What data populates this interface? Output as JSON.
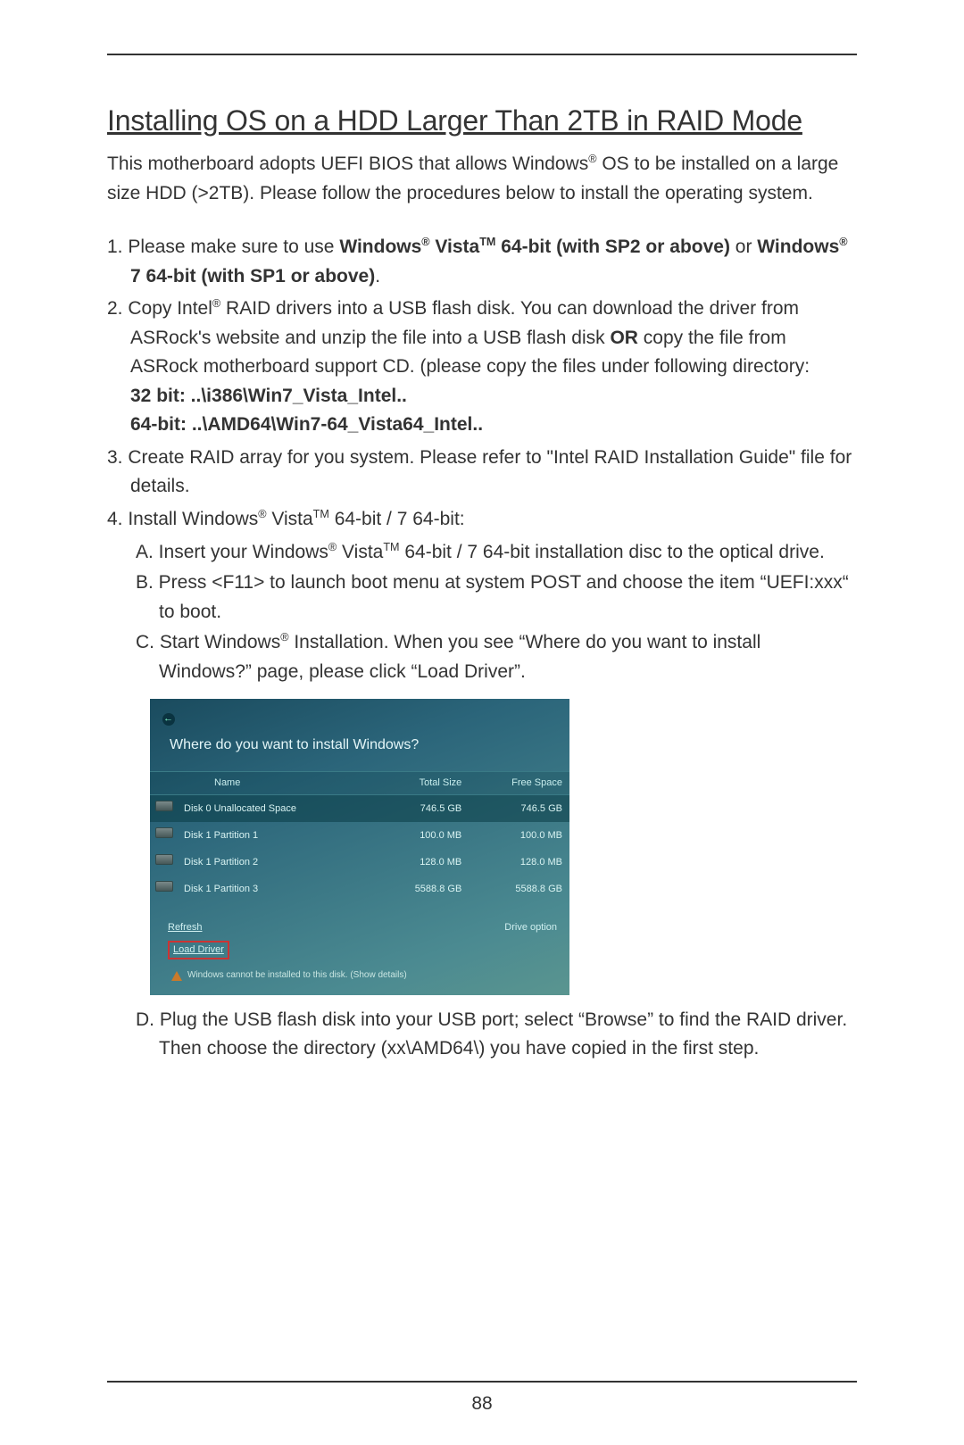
{
  "pageNumber": "88",
  "title": "Installing OS on a HDD Larger Than 2TB in RAID Mode",
  "intro_p1": "This motherboard adopts UEFI BIOS that allows Windows",
  "intro_p2": " OS to be installed on a large size HDD (>2TB). Please follow the procedures below to install the operating system.",
  "step1_a": "1. Please make sure to use ",
  "step1_b": "Windows",
  "step1_c": " Vista",
  "step1_d": " 64-bit (with SP2 or above)",
  "step1_e": " or ",
  "step1_f": "Windows",
  "step1_g": " 7 64-bit (with SP1 or above)",
  "step1_h": ".",
  "step2_a": "2. Copy Intel",
  "step2_b": " RAID drivers into a USB flash disk. You can download the driver from ASRock's website and unzip the file into a USB flash disk ",
  "step2_c": "OR",
  "step2_d": " copy the file from ASRock motherboard support CD. (please copy the files under following directory:",
  "step2_32": "32 bit: ..\\i386\\Win7_Vista_Intel..",
  "step2_64": "64-bit: ..\\AMD64\\Win7-64_Vista64_Intel..",
  "step3": "3. Create RAID array for you system. Please refer to \"Intel RAID Installation Guide\" file for details.",
  "step4_a": "4. Install Windows",
  "step4_b": " Vista",
  "step4_c": " 64-bit / 7 64-bit:",
  "step4A_a": "A. Insert your Windows",
  "step4A_b": " Vista",
  "step4A_c": " 64-bit / 7 64-bit installation disc to the optical drive.",
  "step4B": "B. Press <F11> to launch boot menu at system POST and choose the item “UEFI:xxx“ to boot.",
  "step4C_a": "C. Start Windows",
  "step4C_b": " Installation. When you see “Where do you want to install Windows?” page, please click “Load Driver”.",
  "step4D": "D. Plug the USB flash disk into your USB port; select “Browse” to find the RAID driver. Then choose the directory (xx\\AMD64\\) you have copied in the first step.",
  "sup_reg": "®",
  "sup_tm": "TM",
  "screenshot": {
    "heading": "Where do you want to install Windows?",
    "cols": {
      "name": "Name",
      "total": "Total Size",
      "free": "Free Space"
    },
    "rows": [
      {
        "name": "Disk 0 Unallocated Space",
        "total": "746.5 GB",
        "free": "746.5 GB"
      },
      {
        "name": "Disk 1 Partition 1",
        "total": "100.0 MB",
        "free": "100.0 MB"
      },
      {
        "name": "Disk 1 Partition 2",
        "total": "128.0 MB",
        "free": "128.0 MB"
      },
      {
        "name": "Disk 1 Partition 3",
        "total": "5588.8 GB",
        "free": "5588.8 GB"
      }
    ],
    "refresh": "Refresh",
    "load": "Load Driver",
    "driveopt": "Drive option",
    "warn": "Windows cannot be installed to this disk. (Show details)"
  }
}
